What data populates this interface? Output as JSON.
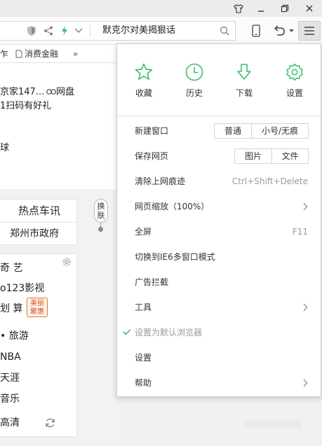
{
  "address_bar": {
    "search_text": "默克尔对美揭狠话"
  },
  "bookmarks": {
    "items": [
      "乍",
      "消费金融",
      "»"
    ]
  },
  "page": {
    "line1": "京家147...",
    "line1_link": "网盘",
    "line2": "1扫码有好礼",
    "line3": "球",
    "hot_title": "热点车讯",
    "hot_sub": "郑州市政府",
    "skin_tab": "换肤",
    "list_items": [
      "奇 艺",
      "o123影视",
      "划 算",
      "• 旅游",
      "NBA",
      "天涯",
      "音乐",
      "高清"
    ],
    "badge": "美丽聚惠"
  },
  "menu": {
    "quick_actions": [
      {
        "label": "收藏",
        "icon": "star-icon"
      },
      {
        "label": "历史",
        "icon": "clock-icon"
      },
      {
        "label": "下载",
        "icon": "download-icon"
      },
      {
        "label": "设置",
        "icon": "gear-icon"
      }
    ],
    "new_window": {
      "label": "新建窗口",
      "opt1": "普通",
      "opt2": "小号/无痕"
    },
    "save_page": {
      "label": "保存网页",
      "opt1": "图片",
      "opt2": "文件"
    },
    "clear_history": {
      "label": "清除上网痕迹",
      "shortcut": "Ctrl+Shift+Delete"
    },
    "zoom": {
      "label": "网页缩放（100%）"
    },
    "fullscreen": {
      "label": "全屏",
      "shortcut": "F11"
    },
    "ie6_mode": {
      "label": "切换到IE6多窗口模式"
    },
    "adblock": {
      "label": "广告拦截"
    },
    "tools": {
      "label": "工具"
    },
    "default_browser": {
      "label": "设置为默认浏览器"
    },
    "settings": {
      "label": "设置"
    },
    "help": {
      "label": "帮助"
    }
  },
  "colors": {
    "accent_green": "#3dbb73"
  }
}
